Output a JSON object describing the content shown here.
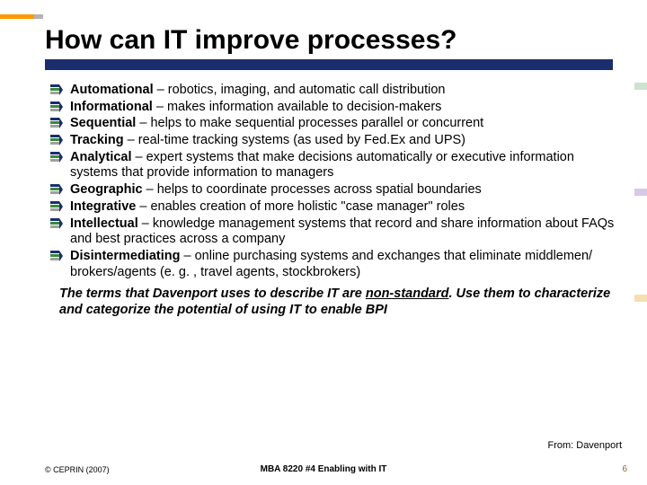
{
  "title": "How can IT improve processes?",
  "bullets": [
    {
      "term": "Automational",
      "desc": " – robotics, imaging, and automatic call distribution"
    },
    {
      "term": "Informational",
      "desc": " – makes information available to decision-makers"
    },
    {
      "term": "Sequential",
      "desc": " – helps to make sequential processes parallel or concurrent"
    },
    {
      "term": "Tracking",
      "desc": " – real-time tracking systems (as used by Fed.Ex and UPS)"
    },
    {
      "term": "Analytical",
      "desc": " – expert systems that make decisions automatically or executive information systems that provide information to managers"
    },
    {
      "term": "Geographic",
      "desc": " – helps to coordinate processes across spatial boundaries"
    },
    {
      "term": "Integrative",
      "desc": " – enables creation of more holistic \"case manager\" roles"
    },
    {
      "term": "Intellectual",
      "desc": " – knowledge management systems that record and share information about FAQs and best practices across a company"
    },
    {
      "term": "Disintermediating",
      "desc": " – online purchasing systems and exchanges that eliminate middlemen/ brokers/agents (e. g. , travel agents, stockbrokers)"
    }
  ],
  "note_pre": "The terms that Davenport uses to describe IT are ",
  "note_underlined": "non-standard",
  "note_post": ". Use them to characterize and categorize the potential of using IT to enable BPI",
  "source": "From: Davenport",
  "footer_left": "© CEPRIN (2007)",
  "footer_center": "MBA 8220 #4 Enabling with IT",
  "footer_right": "6",
  "bullet_svg": "<svg width='14' height='12' viewBox='0 0 14 12'><rect x='0' y='0' width='10' height='3' fill='#1a2e6e'/><rect x='0' y='4' width='10' height='3' fill='#3a8a3a'/><rect x='0' y='8' width='10' height='3' fill='#a0a0a0'/><path d='M10 0 L14 6 L10 12 Z' fill='#1a2e6e'/></svg>"
}
